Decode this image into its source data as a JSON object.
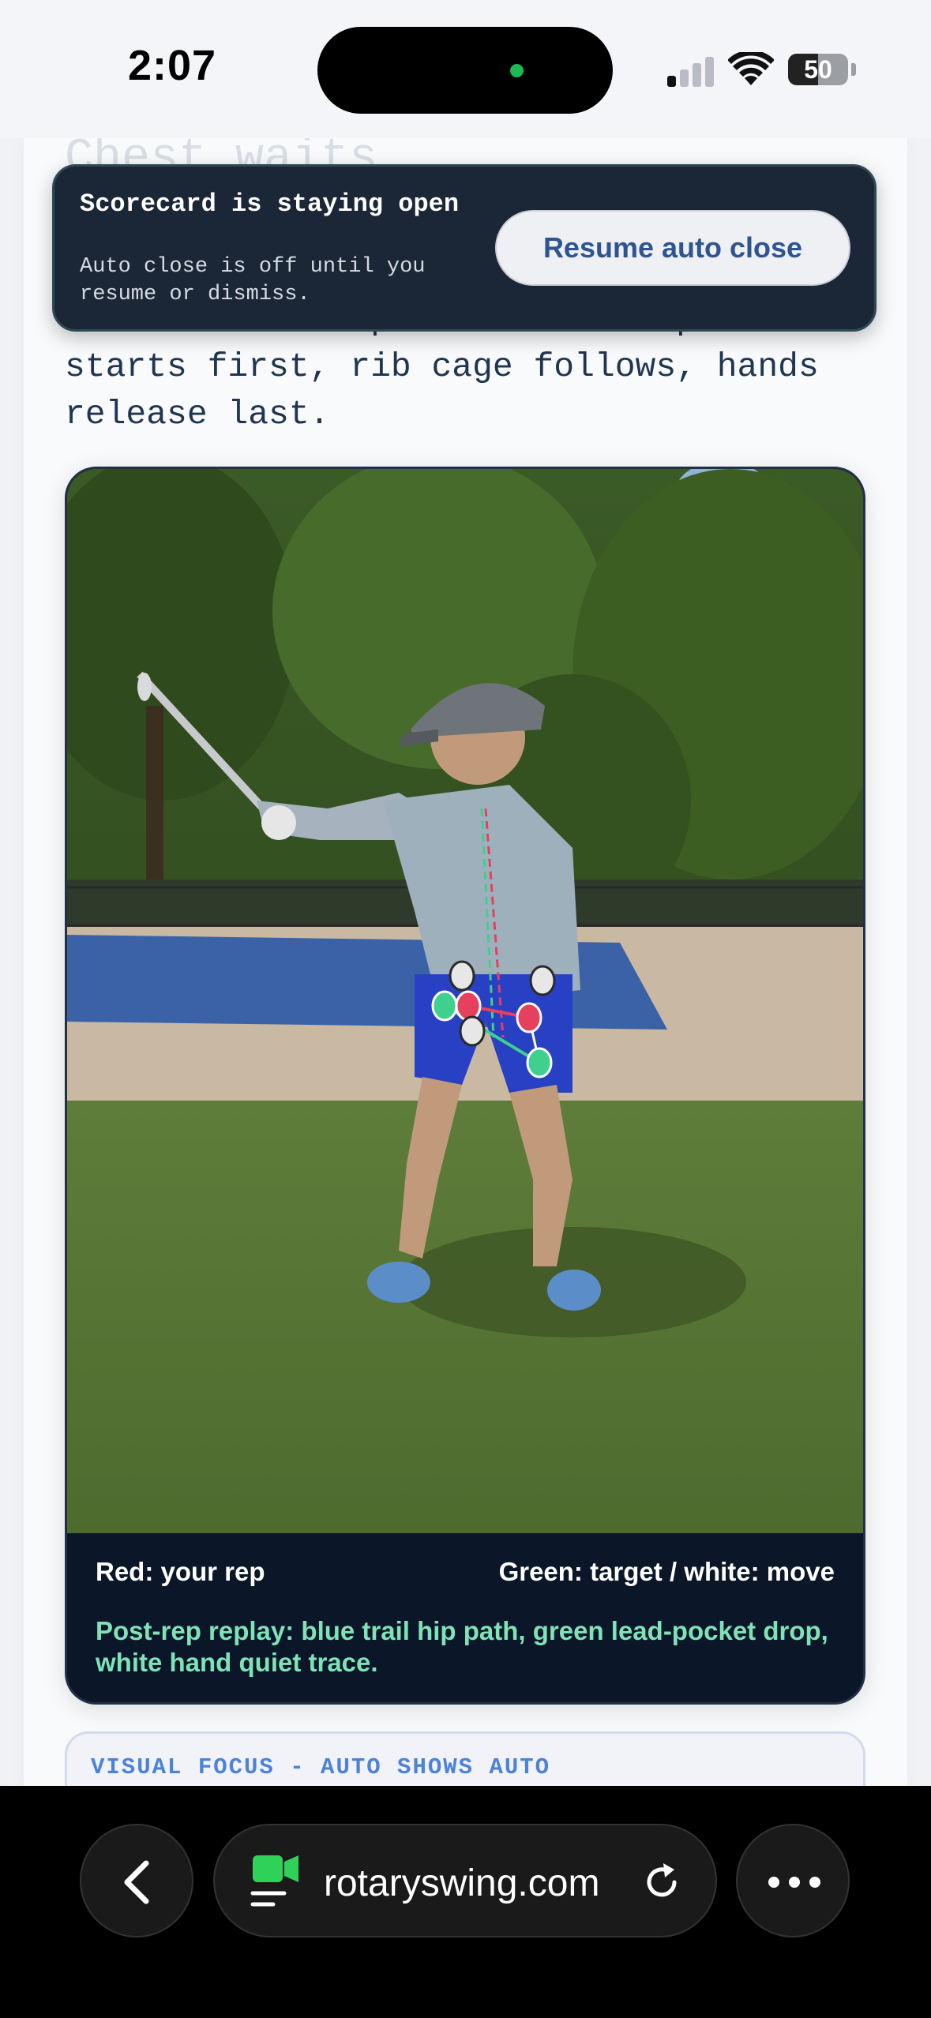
{
  "status_bar": {
    "time": "2:07",
    "battery": "50",
    "battery_level": 0.5,
    "signal_bars_active": 1,
    "signal_bars_total": 4
  },
  "page": {
    "ghost_heading": "Chest waits",
    "body_text": "Correct order: pelvis or lead pocket starts first, rib cage follows, hands release last."
  },
  "toast": {
    "title": "Scorecard is staying open",
    "subtitle": "Auto close is off until you resume or dismiss.",
    "button_label": "Resume auto close"
  },
  "video": {
    "legend_left": "Red: your rep",
    "legend_right": "Green: target / white: move",
    "note": "Post-rep replay: blue trail hip path, green lead-pocket drop, white hand quiet trace."
  },
  "focus_card": {
    "label": "VISUAL FOCUS - AUTO SHOWS AUTO"
  },
  "browser": {
    "url": "rotaryswing.com",
    "icons": {
      "back": "chevron-left-icon",
      "site": "facetime-video-icon",
      "reload": "reload-icon",
      "more": "more-icon"
    }
  },
  "colors": {
    "toast_bg": "#1b2636",
    "legend_note": "#7fe3b8",
    "focus_label": "#4c82d8",
    "marker_red": "#e5405e",
    "marker_green": "#3fcf8e",
    "marker_white": "#e7e7e7"
  }
}
